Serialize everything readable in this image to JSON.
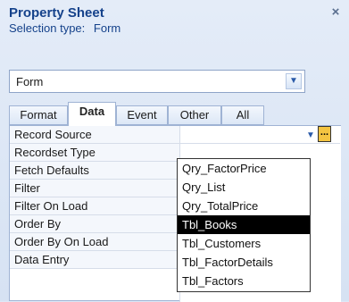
{
  "panel": {
    "title": "Property Sheet",
    "close_glyph": "×",
    "selection_type_label": "Selection type:",
    "selection_type_value": "Form"
  },
  "object_combo": {
    "value": "Form"
  },
  "tabs": [
    {
      "label": "Format"
    },
    {
      "label": "Data"
    },
    {
      "label": "Event"
    },
    {
      "label": "Other"
    },
    {
      "label": "All"
    }
  ],
  "active_tab": "Data",
  "properties": [
    {
      "label": "Record Source"
    },
    {
      "label": "Recordset Type"
    },
    {
      "label": "Fetch Defaults"
    },
    {
      "label": "Filter"
    },
    {
      "label": "Filter On Load"
    },
    {
      "label": "Order By"
    },
    {
      "label": "Order By On Load"
    },
    {
      "label": "Data Entry"
    }
  ],
  "builder_button": "...",
  "record_source_options": [
    {
      "label": "Qry_FactorPrice"
    },
    {
      "label": "Qry_List"
    },
    {
      "label": "Qry_TotalPrice"
    },
    {
      "label": "Tbl_Books"
    },
    {
      "label": "Tbl_Customers"
    },
    {
      "label": "Tbl_FactorDetails"
    },
    {
      "label": "Tbl_Factors"
    }
  ],
  "selected_option": "Tbl_Books",
  "colors": {
    "accent": "#15428b",
    "selection_bg": "#000000",
    "builder_button": "#f4c441"
  }
}
